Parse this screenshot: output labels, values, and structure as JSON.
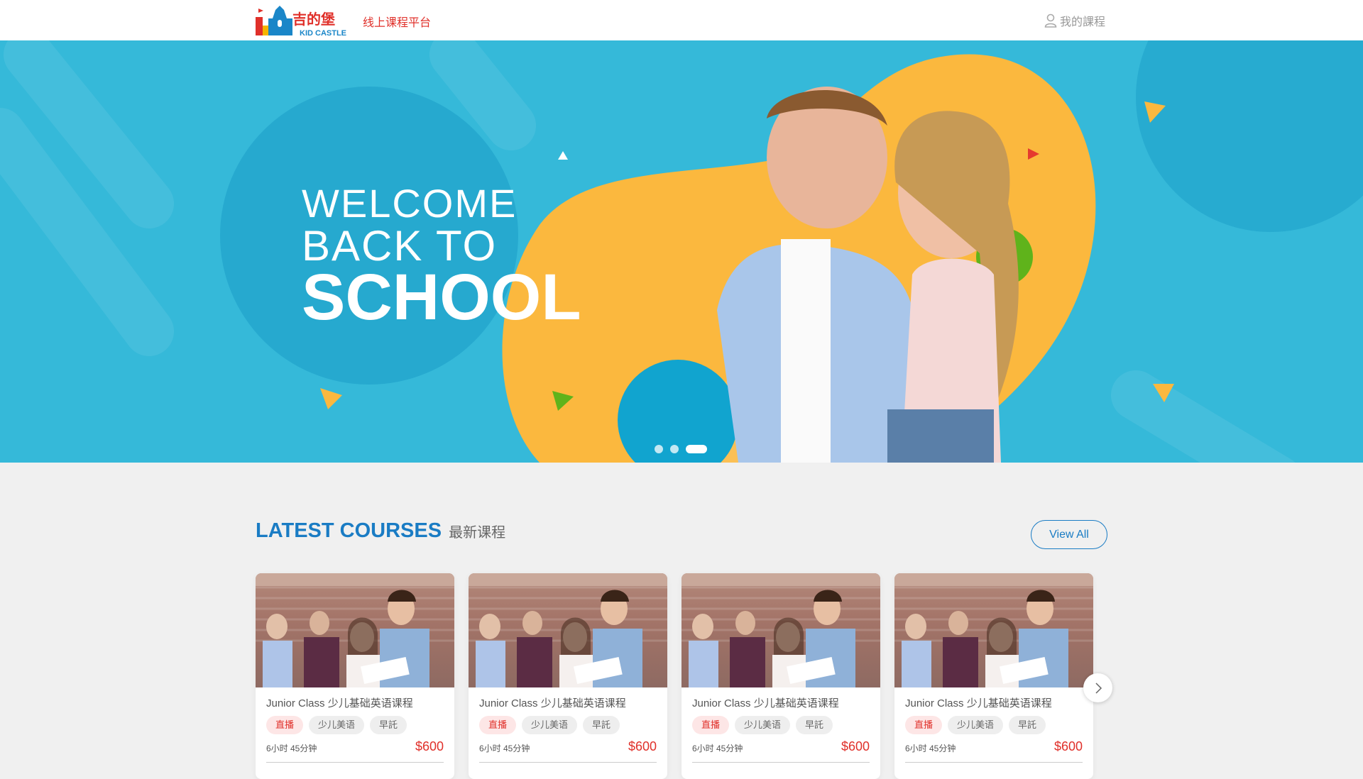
{
  "header": {
    "logo_text": "吉的堡 KID CASTLE",
    "platform_label": "线上课程平台",
    "my_courses_label": "我的課程",
    "my_courses_icon": "user-icon"
  },
  "banner": {
    "line1": "WELCOME",
    "line2": "BACK TO",
    "line3": "SCHOOL",
    "slide_count": 3,
    "active_slide": 3,
    "colors": {
      "background": "#35b9d9",
      "blob": "#fbb83e",
      "accent_green": "#5fb31b",
      "accent_red": "#e53a2f"
    }
  },
  "section": {
    "title_en": "LATEST COURSES",
    "title_cn": "最新课程",
    "view_all_label": "View All"
  },
  "courses": [
    {
      "title": "Junior Class 少儿基础英语课程",
      "tags": [
        "直播",
        "少儿美语",
        "早託"
      ],
      "duration": "6小时 45分钟",
      "price": "$600"
    },
    {
      "title": "Junior Class 少儿基础英语课程",
      "tags": [
        "直播",
        "少儿美语",
        "早託"
      ],
      "duration": "6小时 45分钟",
      "price": "$600"
    },
    {
      "title": "Junior Class 少儿基础英语课程",
      "tags": [
        "直播",
        "少儿美语",
        "早託"
      ],
      "duration": "6小时 45分钟",
      "price": "$600"
    },
    {
      "title": "Junior Class 少儿基础英语课程",
      "tags": [
        "直播",
        "少儿美语",
        "早託"
      ],
      "duration": "6小时 45分钟",
      "price": "$600"
    }
  ],
  "carousel_next_icon": "chevron-right-icon",
  "colors": {
    "brand_blue": "#1a7cc4",
    "price_red": "#e0302a"
  }
}
